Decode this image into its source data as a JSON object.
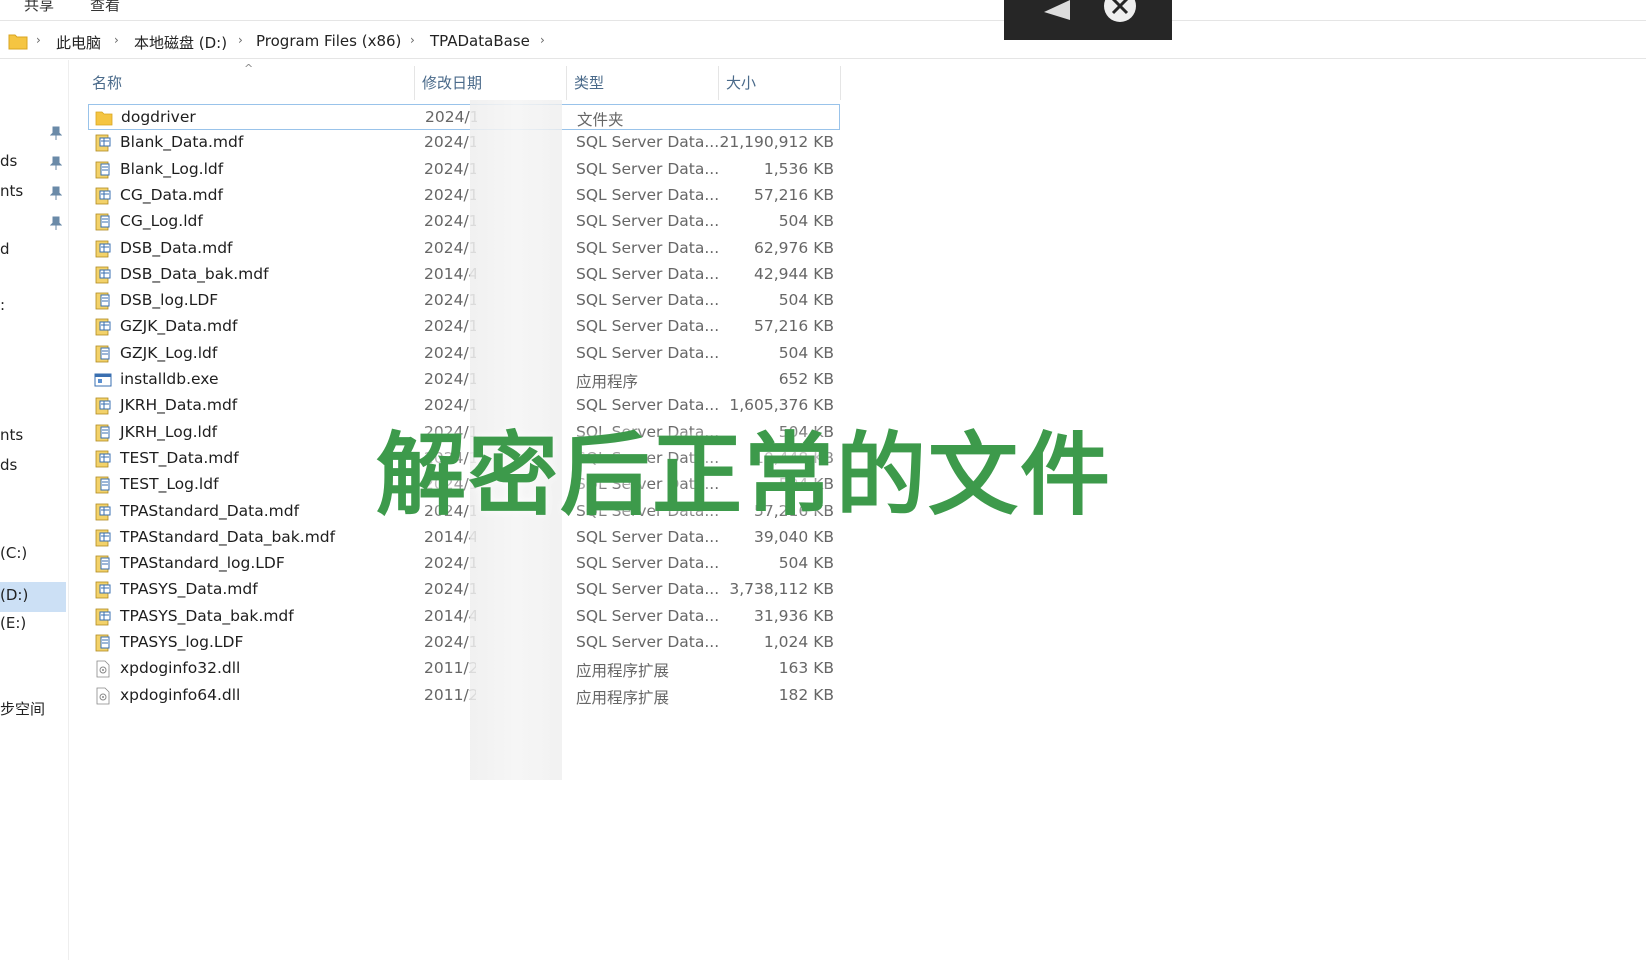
{
  "ribbon": {
    "tab_share": "共享",
    "tab_view": "查看"
  },
  "breadcrumb": [
    "此电脑",
    "本地磁盘 (D:)",
    "Program Files (x86)",
    "TPADataBase"
  ],
  "nav": {
    "items": [
      {
        "label": "ds"
      },
      {
        "label": "nts"
      },
      {
        "label": "d"
      },
      {
        "label": ":"
      },
      {
        "label": "nts"
      },
      {
        "label": "ds"
      },
      {
        "label": "(C:)"
      },
      {
        "label": "(D:)"
      },
      {
        "label": "(E:)"
      },
      {
        "label": "步空间"
      }
    ]
  },
  "columns": {
    "name": "名称",
    "date": "修改日期",
    "type": "类型",
    "size": "大小"
  },
  "files": [
    {
      "name": "dogdriver",
      "date": "2024/1",
      "type": "文件夹",
      "size": "",
      "icon": "folder-icon"
    },
    {
      "name": "Blank_Data.mdf",
      "date": "2024/1",
      "type": "SQL Server Data...",
      "size": "21,190,912 KB",
      "icon": "database-file-icon"
    },
    {
      "name": "Blank_Log.ldf",
      "date": "2024/1",
      "type": "SQL Server Data...",
      "size": "1,536 KB",
      "icon": "log-file-icon"
    },
    {
      "name": "CG_Data.mdf",
      "date": "2024/1",
      "type": "SQL Server Data...",
      "size": "57,216 KB",
      "icon": "database-file-icon"
    },
    {
      "name": "CG_Log.ldf",
      "date": "2024/1",
      "type": "SQL Server Data...",
      "size": "504 KB",
      "icon": "log-file-icon"
    },
    {
      "name": "DSB_Data.mdf",
      "date": "2024/1",
      "type": "SQL Server Data...",
      "size": "62,976 KB",
      "icon": "database-file-icon"
    },
    {
      "name": "DSB_Data_bak.mdf",
      "date": "2014/4",
      "type": "SQL Server Data...",
      "size": "42,944 KB",
      "icon": "database-file-icon"
    },
    {
      "name": "DSB_log.LDF",
      "date": "2024/1",
      "type": "SQL Server Data...",
      "size": "504 KB",
      "icon": "log-file-icon"
    },
    {
      "name": "GZJK_Data.mdf",
      "date": "2024/1",
      "type": "SQL Server Data...",
      "size": "57,216 KB",
      "icon": "database-file-icon"
    },
    {
      "name": "GZJK_Log.ldf",
      "date": "2024/1",
      "type": "SQL Server Data...",
      "size": "504 KB",
      "icon": "log-file-icon"
    },
    {
      "name": "installdb.exe",
      "date": "2024/1",
      "type": "应用程序",
      "size": "652 KB",
      "icon": "exe-file-icon"
    },
    {
      "name": "JKRH_Data.mdf",
      "date": "2024/1",
      "type": "SQL Server Data...",
      "size": "1,605,376 KB",
      "icon": "database-file-icon"
    },
    {
      "name": "JKRH_Log.ldf",
      "date": "2024/1",
      "type": "SQL Server Data...",
      "size": "504 KB",
      "icon": "log-file-icon"
    },
    {
      "name": "TEST_Data.mdf",
      "date": "2024/1",
      "type": "SQL Server Data...",
      "size": "10,448 KB",
      "icon": "database-file-icon"
    },
    {
      "name": "TEST_Log.ldf",
      "date": "2024/1",
      "type": "SQL Server Data...",
      "size": "504 KB",
      "icon": "log-file-icon"
    },
    {
      "name": "TPAStandard_Data.mdf",
      "date": "2024/1",
      "type": "SQL Server Data...",
      "size": "57,216 KB",
      "icon": "database-file-icon"
    },
    {
      "name": "TPAStandard_Data_bak.mdf",
      "date": "2014/4",
      "type": "SQL Server Data...",
      "size": "39,040 KB",
      "icon": "database-file-icon"
    },
    {
      "name": "TPAStandard_log.LDF",
      "date": "2024/1",
      "type": "SQL Server Data...",
      "size": "504 KB",
      "icon": "log-file-icon"
    },
    {
      "name": "TPASYS_Data.mdf",
      "date": "2024/1",
      "type": "SQL Server Data...",
      "size": "3,738,112 KB",
      "icon": "database-file-icon"
    },
    {
      "name": "TPASYS_Data_bak.mdf",
      "date": "2014/4",
      "type": "SQL Server Data...",
      "size": "31,936 KB",
      "icon": "database-file-icon"
    },
    {
      "name": "TPASYS_log.LDF",
      "date": "2024/1",
      "type": "SQL Server Data...",
      "size": "1,024 KB",
      "icon": "log-file-icon"
    },
    {
      "name": "xpdoginfo32.dll",
      "date": "2011/2",
      "type": "应用程序扩展",
      "size": "163 KB",
      "icon": "dll-file-icon"
    },
    {
      "name": "xpdoginfo64.dll",
      "date": "2011/2",
      "type": "应用程序扩展",
      "size": "182 KB",
      "icon": "dll-file-icon"
    }
  ],
  "overlay_caption": "解密后正常的文件",
  "colors": {
    "caption_green": "#3d9a4b",
    "folder_yellow": "#f5c542",
    "selection_border": "#99c3ea"
  }
}
